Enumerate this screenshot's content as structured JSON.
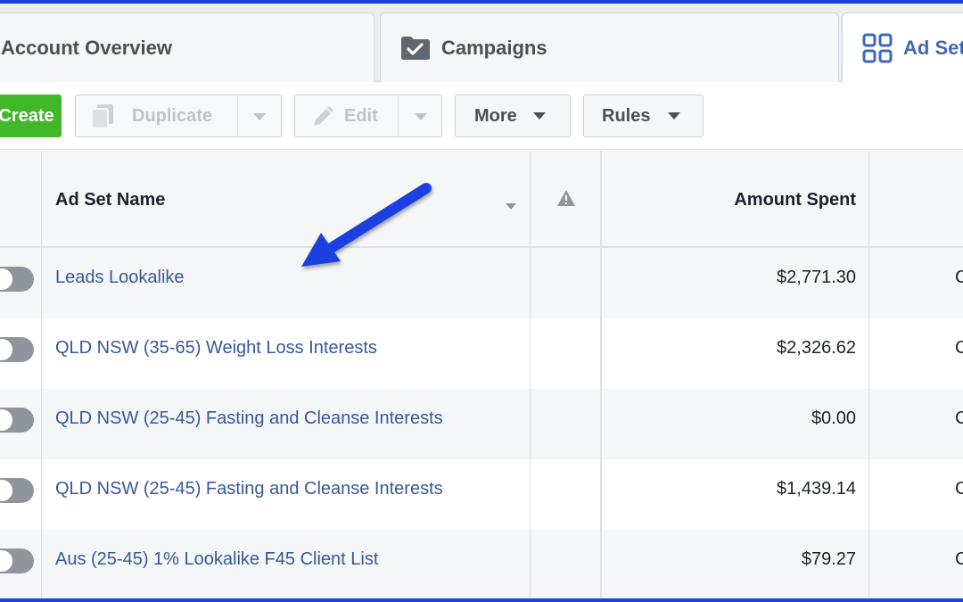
{
  "tabs": {
    "overview": "Account Overview",
    "campaigns": "Campaigns",
    "adsets": "Ad Sets"
  },
  "toolbar": {
    "create": "Create",
    "duplicate": "Duplicate",
    "edit": "Edit",
    "more": "More",
    "rules": "Rules"
  },
  "table": {
    "headers": {
      "name": "Ad Set Name",
      "amount": "Amount Spent"
    },
    "rows": [
      {
        "name": "Leads Lookalike",
        "amount": "$2,771.30",
        "extra": "C"
      },
      {
        "name": "QLD NSW (35-65) Weight Loss Interests",
        "amount": "$2,326.62",
        "extra": "C"
      },
      {
        "name": "QLD NSW (25-45) Fasting and Cleanse Interests",
        "amount": "$0.00",
        "extra": "C"
      },
      {
        "name": "QLD NSW (25-45) Fasting and Cleanse Interests",
        "amount": "$1,439.14",
        "extra": "C"
      },
      {
        "name": "Aus (25-45) 1% Lookalike F45 Client List",
        "amount": "$79.27",
        "extra": "C"
      }
    ]
  },
  "icons": {
    "campaigns": "checked-folder-icon",
    "adsets": "grid-icon",
    "duplicate": "copy-icon",
    "edit": "pencil-icon",
    "warning": "warning-icon",
    "annotation": "blue-arrow"
  },
  "colors": {
    "accent": "#4267b2",
    "link": "#365899",
    "create": "#42b72a",
    "frame": "#1f3fe0"
  }
}
